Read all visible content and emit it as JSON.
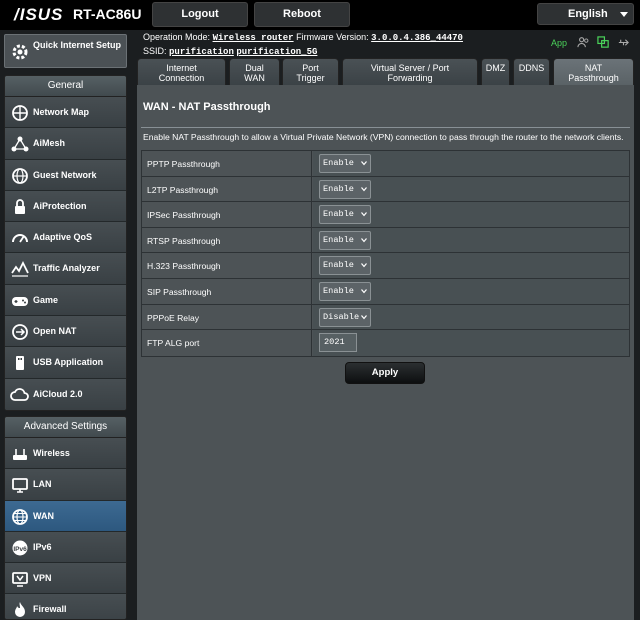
{
  "header": {
    "brand": "/ISUS",
    "model": "RT-AC86U",
    "logout_label": "Logout",
    "reboot_label": "Reboot",
    "language": "English"
  },
  "status": {
    "operation_mode_label": "Operation Mode:",
    "operation_mode_value": "Wireless router",
    "firmware_label": "Firmware Version:",
    "firmware_value": "3.0.0.4.386_44470",
    "ssid_label": "SSID:",
    "ssid_1": "purification",
    "ssid_2": "purification_5G",
    "app_label": "App"
  },
  "sidebar": {
    "quick_setup": "Quick Internet Setup",
    "general_header": "General",
    "general_items": [
      {
        "label": "Network Map",
        "icon": "network-map-icon"
      },
      {
        "label": "AiMesh",
        "icon": "aimesh-icon"
      },
      {
        "label": "Guest Network",
        "icon": "guest-network-icon"
      },
      {
        "label": "AiProtection",
        "icon": "aiprotection-icon"
      },
      {
        "label": "Adaptive QoS",
        "icon": "qos-gauge-icon"
      },
      {
        "label": "Traffic Analyzer",
        "icon": "traffic-analyzer-icon"
      },
      {
        "label": "Game",
        "icon": "gamepad-icon"
      },
      {
        "label": "Open NAT",
        "icon": "open-nat-icon"
      },
      {
        "label": "USB Application",
        "icon": "usb-icon"
      },
      {
        "label": "AiCloud 2.0",
        "icon": "aicloud-icon"
      }
    ],
    "advanced_header": "Advanced Settings",
    "advanced_items": [
      {
        "label": "Wireless",
        "icon": "wireless-icon"
      },
      {
        "label": "LAN",
        "icon": "lan-icon"
      },
      {
        "label": "WAN",
        "icon": "wan-globe-icon"
      },
      {
        "label": "IPv6",
        "icon": "ipv6-icon"
      },
      {
        "label": "VPN",
        "icon": "vpn-icon"
      },
      {
        "label": "Firewall",
        "icon": "firewall-icon"
      }
    ],
    "active_item": "WAN"
  },
  "tabs": [
    {
      "label_line1": "Internet",
      "label_line2": "Connection"
    },
    {
      "label_line1": "Dual",
      "label_line2": "WAN"
    },
    {
      "label_line1": "Port",
      "label_line2": "Trigger"
    },
    {
      "label_line1": "Virtual Server / Port",
      "label_line2": "Forwarding"
    },
    {
      "label_line1": "DMZ",
      "label_line2": ""
    },
    {
      "label_line1": "DDNS",
      "label_line2": ""
    },
    {
      "label_line1": "NAT",
      "label_line2": "Passthrough"
    }
  ],
  "page": {
    "title": "WAN - NAT Passthrough",
    "description": "Enable NAT Passthrough to allow a Virtual Private Network (VPN) connection to pass through the router to the network clients.",
    "apply_label": "Apply"
  },
  "settings": [
    {
      "label": "PPTP Passthrough",
      "value": "Enable"
    },
    {
      "label": "L2TP Passthrough",
      "value": "Enable"
    },
    {
      "label": "IPSec Passthrough",
      "value": "Enable"
    },
    {
      "label": "RTSP Passthrough",
      "value": "Enable"
    },
    {
      "label": "H.323 Passthrough",
      "value": "Enable"
    },
    {
      "label": "SIP Passthrough",
      "value": "Enable"
    },
    {
      "label": "PPPoE Relay",
      "value": "Disable"
    },
    {
      "label": "FTP ALG port",
      "value": "2021"
    }
  ],
  "colors": {
    "accent_active": "#2d587f",
    "app_green": "#4ad25a"
  }
}
